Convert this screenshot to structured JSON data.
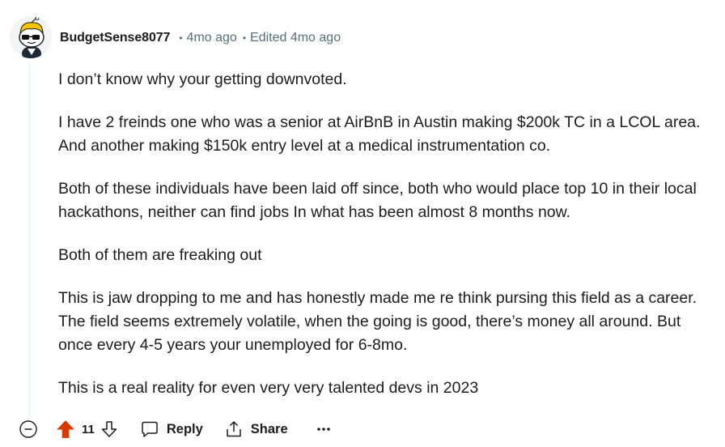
{
  "comment": {
    "author": "BudgetSense8077",
    "age": "4mo ago",
    "edited": "Edited 4mo ago",
    "paragraphs": [
      "I don’t know why your getting downvoted.",
      "I have 2 freinds one who was a senior at AirBnB in Austin making $200k TC in a LCOL area. And another making $150k entry level at a medical instrumentation co.",
      "Both of these individuals have been laid off since, both who would place top 10 in their local hackathons, neither can find jobs In what has been almost 8 months now.",
      "Both of them are freaking out",
      "This is jaw dropping to me and has honestly made me re think pursing this field as a career. The field seems extremely volatile, when the going is good, there’s money all around. But once every 4-5 years your unemployed for 6-8mo.",
      "This is a real reality for even very very talented devs in 2023"
    ],
    "score": "11",
    "upvoted": true
  },
  "actions": {
    "reply_label": "Reply",
    "share_label": "Share"
  },
  "icons": {
    "collapse": "minus-circle-icon",
    "upvote": "upvote-arrow-icon",
    "downvote": "downvote-arrow-icon",
    "reply": "speech-bubble-icon",
    "share": "share-icon",
    "more": "ellipsis-icon"
  },
  "colors": {
    "upvote_active": "#d93900",
    "muted": "#576f76",
    "thread_line": "#e5ebee"
  }
}
